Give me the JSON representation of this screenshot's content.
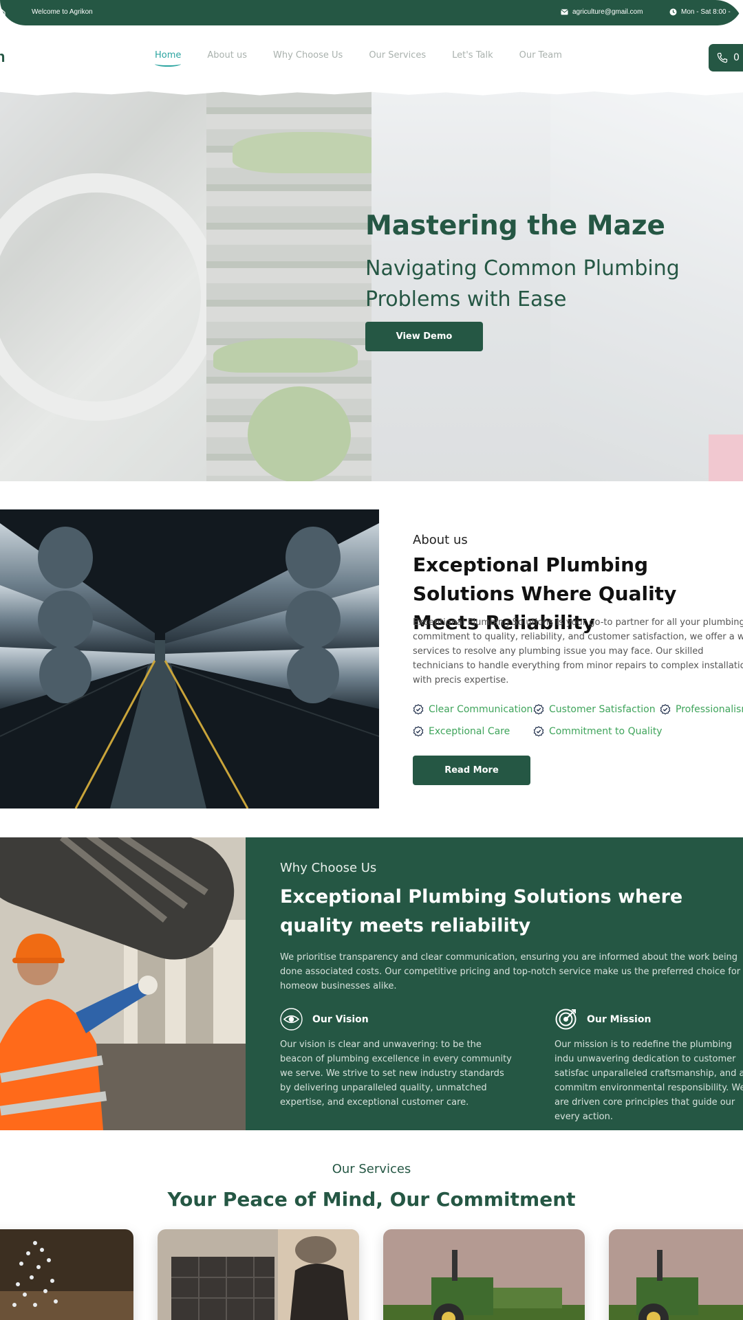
{
  "brand": {
    "primary": "#255744",
    "accent": "#2aa4a0",
    "feature_green": "#3fa45b",
    "logo_text": "n"
  },
  "topbar": {
    "welcome": "Welcome to Agrikon",
    "email": "agriculture@gmail.com",
    "hours": "Mon - Sat 8:00 -"
  },
  "nav": {
    "items": [
      {
        "label": "Home",
        "active": true
      },
      {
        "label": "About us"
      },
      {
        "label": "Why Choose Us"
      },
      {
        "label": "Our Services"
      },
      {
        "label": "Let's Talk"
      },
      {
        "label": "Our Team"
      }
    ],
    "call_label": "0"
  },
  "hero": {
    "title": "Mastering the Maze",
    "subtitle": "Navigating Common Plumbing Problems with Ease",
    "button": "View Demo"
  },
  "about": {
    "eyebrow": "About us",
    "heading": "Exceptional Plumbing Solutions Where Quality Meets Reliability",
    "body": "Exceptional Plumbing Solutions is your go-to partner for all your plumbing r commitment to quality, reliability, and customer satisfaction, we offer a wid services to resolve any plumbing issue you may face. Our skilled technicians to handle everything from minor repairs to complex installations with precis expertise.",
    "features": [
      "Clear Communication",
      "Customer Satisfaction",
      "Professionalism",
      "Exceptional Care",
      "Commitment to Quality"
    ],
    "button": "Read More"
  },
  "why": {
    "eyebrow": "Why Choose Us",
    "heading": "Exceptional Plumbing Solutions where quality meets reliability",
    "body": "We prioritise transparency and clear communication, ensuring you are informed about the work being done associated costs. Our competitive pricing and top-notch service make us the preferred choice for homeow businesses alike.",
    "vision": {
      "title": "Our Vision",
      "icon": "eye-icon",
      "text": "Our vision is clear and unwavering: to be the beacon of plumbing excellence in every community we serve. We strive to set new industry standards by delivering unparalleled quality, unmatched expertise, and exceptional customer care."
    },
    "mission": {
      "title": "Our Mission",
      "icon": "target-icon",
      "text": "Our mission is to redefine the plumbing indu unwavering dedication to customer satisfac unparalleled craftsmanship, and a commitm environmental responsibility. We are driven core principles that guide our every action."
    }
  },
  "services": {
    "eyebrow": "Our Services",
    "heading": "Your Peace of Mind, Our Commitment"
  }
}
